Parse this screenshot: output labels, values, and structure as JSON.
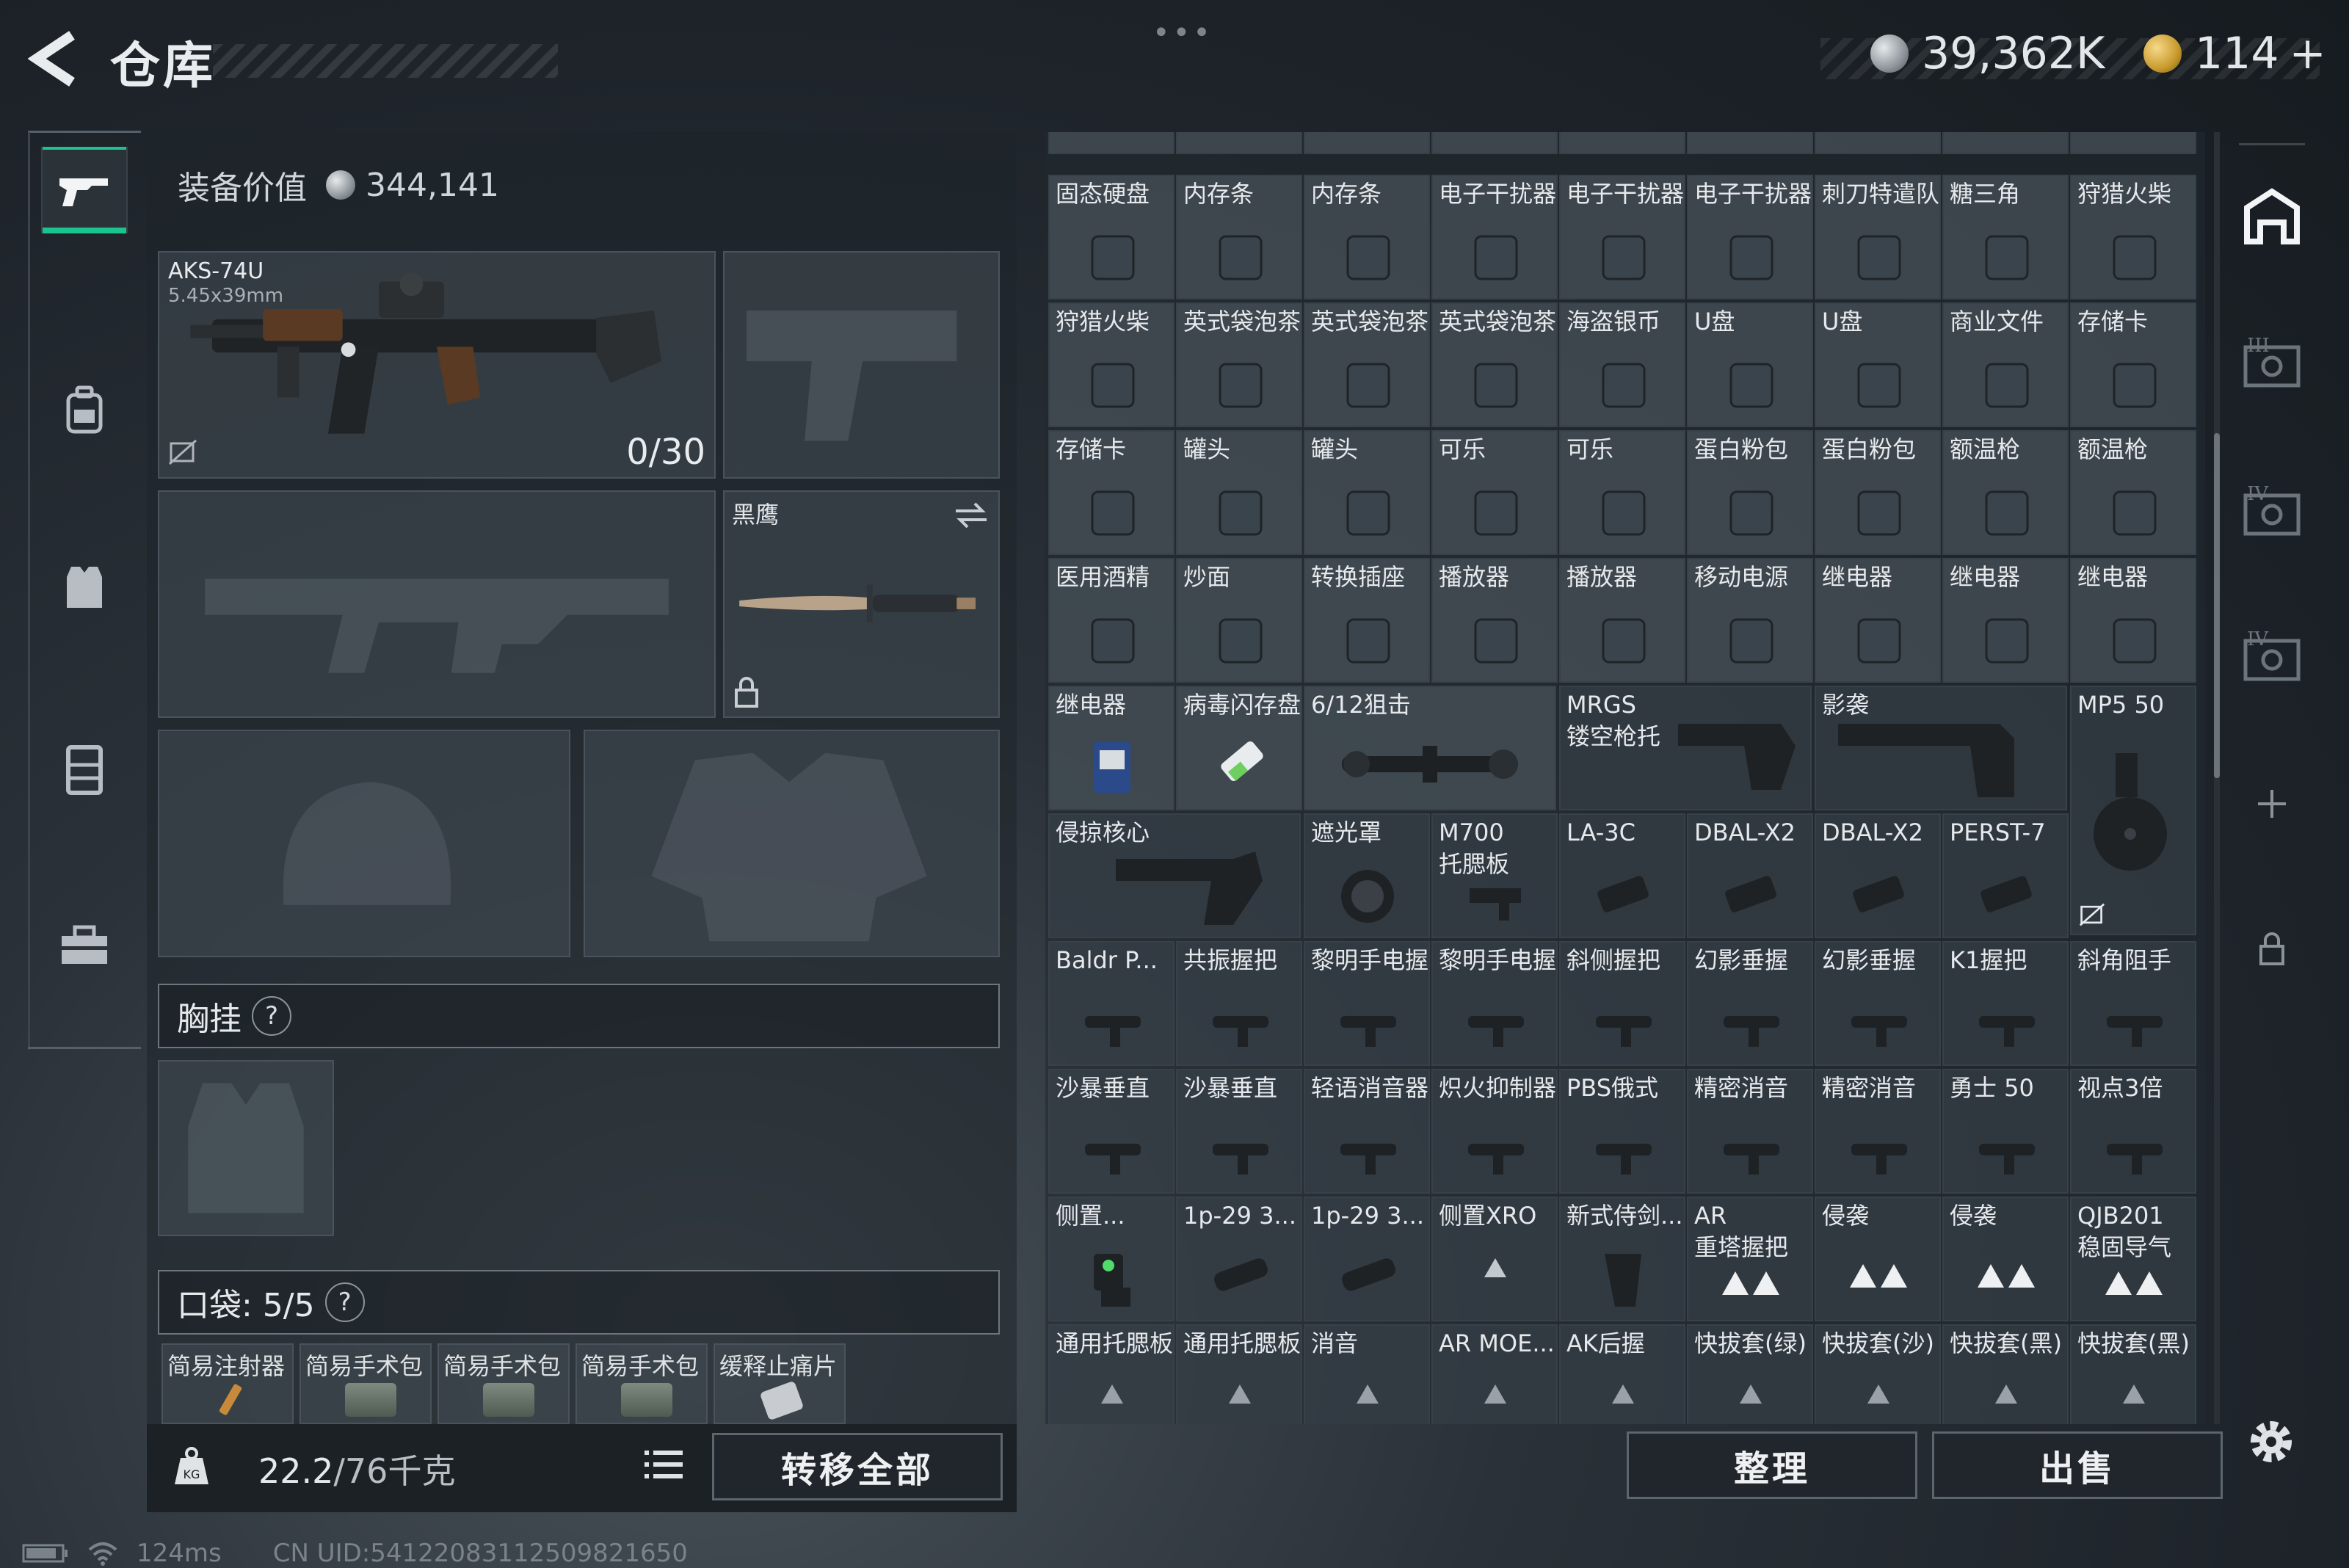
{
  "header": {
    "title": "仓库",
    "currency_silver": "39,362K",
    "currency_gold": "114",
    "add_label": "+",
    "dots": "•••",
    "version": ""
  },
  "left_tabs": [
    "gun-icon",
    "backpack-icon",
    "rig-icon",
    "armor-icon",
    "toolbox-icon"
  ],
  "loadout": {
    "equip_value_label": "装备价值",
    "equip_value": "344,141",
    "primary": {
      "name": "AKS-74U",
      "caliber": "5.45x39mm",
      "ammo": "0/30"
    },
    "melee": {
      "label": "黑鹰"
    },
    "chest_rig_label": "胸挂",
    "pocket_label": "口袋: 5/5",
    "pockets": [
      "简易注射器",
      "简易手术包",
      "简易手术包",
      "简易手术包",
      "缓释止痛片"
    ],
    "weight": "22.2",
    "weight_max": "/76千克",
    "transfer_all": "转移全部"
  },
  "inventory": {
    "rows": [
      [
        "固态硬盘",
        "内存条",
        "内存条",
        "电子干扰器",
        "电子干扰器",
        "电子干扰器",
        "刺刀特遣队",
        "糖三角",
        "狩猎火柴"
      ],
      [
        "狩猎火柴",
        "英式袋泡茶",
        "英式袋泡茶",
        "英式袋泡茶",
        "海盗银币",
        "U盘",
        "U盘",
        "商业文件",
        "存储卡"
      ],
      [
        "存储卡",
        "罐头",
        "罐头",
        "可乐",
        "可乐",
        "蛋白粉包",
        "蛋白粉包",
        "额温枪",
        "额温枪"
      ],
      [
        "医用酒精",
        "炒面",
        "转换插座",
        "播放器",
        "播放器",
        "移动电源",
        "继电器",
        "继电器",
        "继电器"
      ]
    ],
    "row5": {
      "relay": "继电器",
      "usb": "病毒闪存盘",
      "scope": "6/12狙击",
      "mrgs": "MRGS",
      "mrgs2": "镂空枪托",
      "shadow": "影袭",
      "mp5": "MP5 50"
    },
    "row6": {
      "invade": "侵掠核心",
      "shade": "遮光罩",
      "m700": "M700",
      "m700b": "托腮板",
      "la3c": "LA-3C",
      "dbal1": "DBAL-X2",
      "dbal2": "DBAL-X2",
      "perst": "PERST-7"
    },
    "row7": [
      "Baldr P...",
      "共振握把",
      "黎明手电握",
      "黎明手电握",
      "斜侧握把",
      "幻影垂握",
      "幻影垂握",
      "K1握把",
      "斜角阻手"
    ],
    "row8": [
      "沙暴垂直",
      "沙暴垂直",
      "轻语消音器",
      "炽火抑制器",
      "PBS俄式",
      "精密消音",
      "精密消音",
      "勇士 50",
      "视点3倍"
    ],
    "row9": {
      "a": "侧置...",
      "b": "1p-29 3...",
      "c": "1p-29 3...",
      "d": "侧置XRO",
      "e": "新式侍剑...",
      "f": "AR",
      "f2": "重塔握把",
      "g": "侵袭",
      "h": "侵袭",
      "i": "QJB201",
      "i2": "稳固导气"
    },
    "row10": [
      "通用托腮板",
      "通用托腮板",
      "消音",
      "AR MOE...",
      "AK后握",
      "快拔套(绿)",
      "快拔套(沙)",
      "快拔套(黑)",
      "快拔套(黑)"
    ]
  },
  "footer": {
    "sort": "整理",
    "sell": "出售"
  },
  "status": {
    "ping": "124ms",
    "uid": "CN UID:54122083112509821650"
  }
}
